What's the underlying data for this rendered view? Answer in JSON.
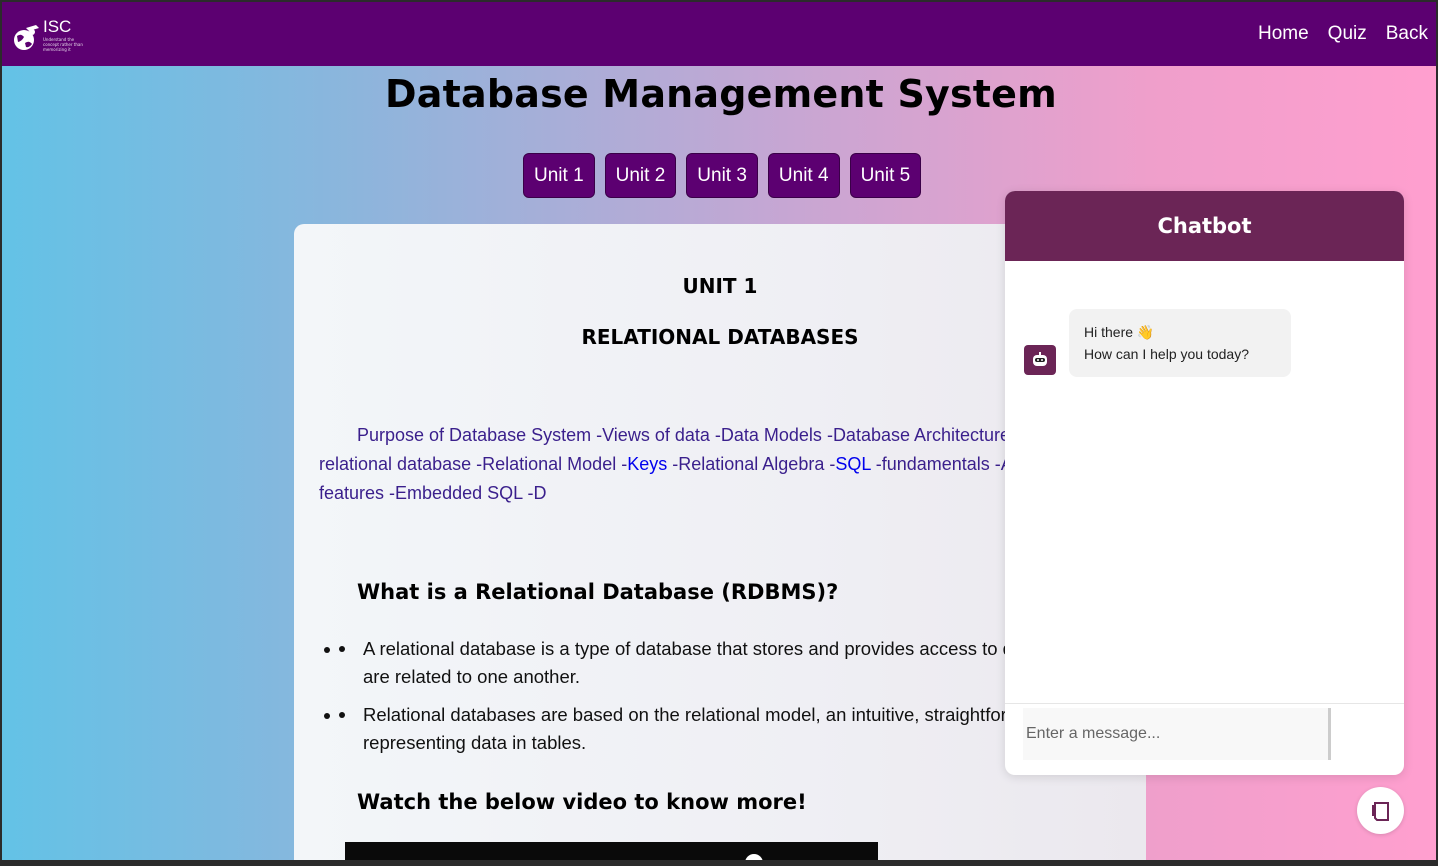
{
  "navbar": {
    "logo_text": "ISC",
    "logo_tagline": "Understand the concept rather than memorizing it",
    "links": [
      "Home",
      "Quiz",
      "Back"
    ]
  },
  "page": {
    "title": "Database Management System",
    "unit_tabs": [
      "Unit 1",
      "Unit 2",
      "Unit 3",
      "Unit 4",
      "Unit 5"
    ]
  },
  "content": {
    "unit_heading": "UNIT 1",
    "unit_subheading": "RELATIONAL DATABASES",
    "topics": [
      {
        "text": "Purpose of Database System",
        "link": false
      },
      {
        "text": " -",
        "link": false
      },
      {
        "text": "Views of data",
        "link": false
      },
      {
        "text": " -",
        "link": false
      },
      {
        "text": "Data Models",
        "link": false
      },
      {
        "text": " -",
        "link": false
      },
      {
        "text": "Database Architecture",
        "link": false
      },
      {
        "text": " -",
        "link": false
      },
      {
        "text": "Introduction to relational database",
        "link": false
      },
      {
        "text": " -",
        "link": false
      },
      {
        "text": "Relational Model",
        "link": false
      },
      {
        "text": " -",
        "link": false
      },
      {
        "text": "Keys",
        "link": true
      },
      {
        "text": " -",
        "link": false
      },
      {
        "text": "Relational Algebra",
        "link": false
      },
      {
        "text": " -",
        "link": false
      },
      {
        "text": "SQL",
        "link": true
      },
      {
        "text": " -",
        "link": false
      },
      {
        "text": "fundamentals",
        "link": false
      },
      {
        "text": " -",
        "link": false
      },
      {
        "text": "Advanced SQL features",
        "link": false
      },
      {
        "text": " -",
        "link": false
      },
      {
        "text": "Embedded SQL",
        "link": false
      },
      {
        "text": " -",
        "link": false
      },
      {
        "text": "D",
        "link": false
      }
    ],
    "section1_title": "What is a Relational Database (RDBMS)?",
    "bullets": [
      "A relational database is a type of database that stores and provides access to data points that are related to one another.",
      "Relational databases are based on the relational model, an intuitive, straightforward way of representing data in tables."
    ],
    "section2_title": "Watch the below video to know more!"
  },
  "chatbot": {
    "title": "Chatbot",
    "greeting_line1": "Hi there 👋",
    "greeting_line2": "How can I help you today?",
    "input_placeholder": "Enter a message...",
    "header_color": "#6b2556"
  },
  "colors": {
    "navbar": "#5c0071",
    "unit_tab": "#5c0071"
  }
}
